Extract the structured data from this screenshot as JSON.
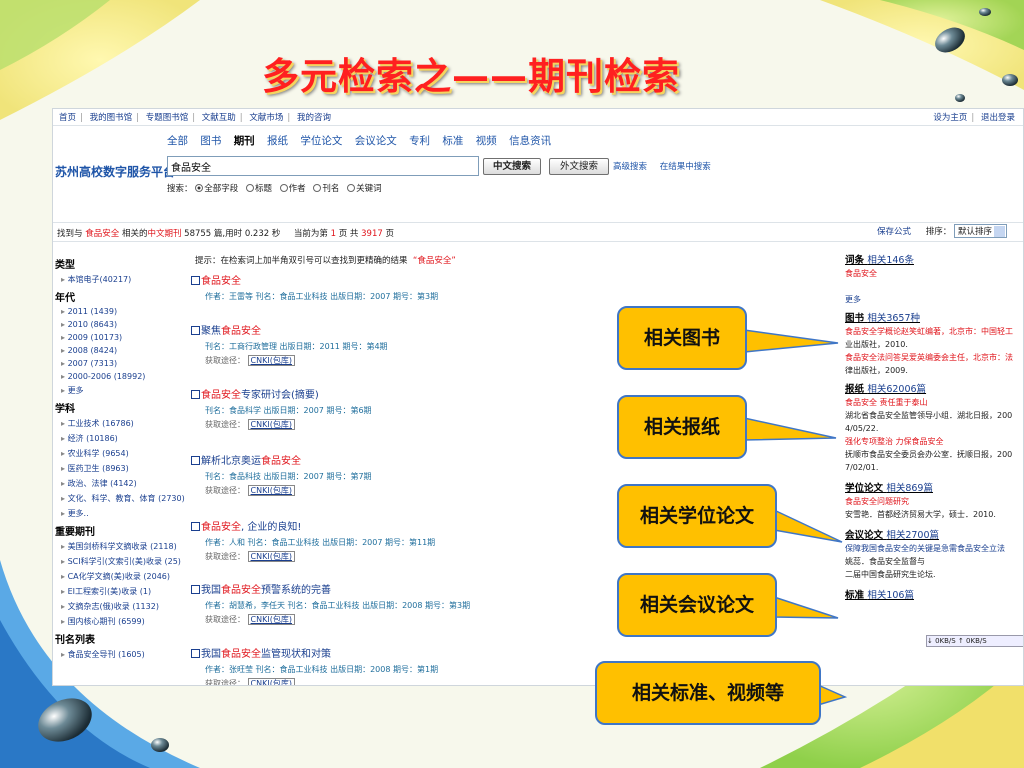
{
  "slide": {
    "title": "多元检索之——期刊检索"
  },
  "topnav": {
    "left": [
      "首页",
      "我的图书馆",
      "专题图书馆",
      "文献互助",
      "文献市场",
      "我的咨询"
    ],
    "right": [
      "设为主页",
      "退出登录"
    ]
  },
  "brand": "苏州高校数字服务平台",
  "search": {
    "types": [
      "全部",
      "图书",
      "期刊",
      "报纸",
      "学位论文",
      "会议论文",
      "专利",
      "标准",
      "视频",
      "信息资讯"
    ],
    "active_type": "期刊",
    "query": "食品安全",
    "cn_button": "中文搜索",
    "en_button": "外文搜索",
    "advanced": "高级搜索",
    "within": "在结果中搜索",
    "scope_label": "搜索：",
    "scopes": [
      "全部字段",
      "标题",
      "作者",
      "刊名",
      "关键词"
    ],
    "selected_scope": "全部字段"
  },
  "status": {
    "p1": "找到与",
    "keyword": "食品安全",
    "p2": "相关的",
    "type": "中文期刊",
    "p3": "58755 篇,用时 0.232 秒",
    "p4": "当前为第",
    "page": "1",
    "p5": "页 共",
    "total": "3917",
    "p6": "页",
    "save": "保存公式",
    "sort_label": "排序：",
    "sort_value": "默认排序"
  },
  "sidebar": [
    {
      "heading": "类型",
      "items": [
        "本馆电子(40217)"
      ]
    },
    {
      "heading": "年代",
      "items": [
        "2011 (1439)",
        "2010 (8643)",
        "2009 (10173)",
        "2008 (8424)",
        "2007 (7313)",
        "2000-2006 (18992)",
        "更多"
      ]
    },
    {
      "heading": "学科",
      "items": [
        "工业技术 (16786)",
        "经济 (10186)",
        "农业科学 (9654)",
        "医药卫生 (8963)",
        "政治、法律 (4142)",
        "文化、科学、教育、体育 (2730)",
        "更多.."
      ]
    },
    {
      "heading": "重要期刊",
      "items": [
        "美国剑桥科学文摘收录 (2118)",
        "SCI科学引(文索引(美)收录 (25)",
        "CA化学文摘(美)收录 (2046)",
        "EI工程索引(美)收录 (1)",
        "文摘杂志(俄)收录 (1132)",
        "国内核心期刊 (6599)"
      ]
    },
    {
      "heading": "刊名列表",
      "items": [
        "食品安全导刊 (1605)"
      ]
    }
  ],
  "hint": {
    "text": "提示：在检索词上加半角双引号可以查找到更精确的结果",
    "quoted": "“食品安全”"
  },
  "results": [
    {
      "pre": "",
      "hl": "食品安全",
      "post": "",
      "meta": "作者：王雷等    刊名：食品工业科技    出版日期：2007    期号：第3期",
      "route": ""
    },
    {
      "pre": "聚焦",
      "hl": "食品安全",
      "post": "",
      "meta": "刊名：工商行政管理    出版日期：2011    期号：第4期",
      "route": "CNKI(包库)"
    },
    {
      "pre": "",
      "hl": "食品安全",
      "post": "专家研讨会(摘要)",
      "meta": "刊名：食品科学    出版日期：2007    期号：第6期",
      "route": "CNKI(包库)"
    },
    {
      "pre": "解析北京奥运",
      "hl": "食品安全",
      "post": "",
      "meta": "刊名：食品科技    出版日期：2007    期号：第7期",
      "route": "CNKI(包库)"
    },
    {
      "pre": "",
      "hl": "食品安全",
      "post": ", 企业的良知!",
      "meta": "作者：人和    刊名：食品工业科技    出版日期：2007    期号：第11期",
      "route": "CNKI(包库)"
    },
    {
      "pre": "我国",
      "hl": "食品安全",
      "post": "预警系统的完善",
      "meta": "作者：胡慧希，李任天    刊名：食品工业科技    出版日期：2008    期号：第3期",
      "route": "CNKI(包库)"
    },
    {
      "pre": "我国",
      "hl": "食品安全",
      "post": "监管现状和对策",
      "meta": "作者：张旺莹    刊名：食品工业科技    出版日期：2008    期号：第1期",
      "route": "CNKI(包库)"
    }
  ],
  "route_label": "获取途径：",
  "right_panel": {
    "entry_h": "词条",
    "entry_cnt": "相关146条",
    "entry_item": "食品安全",
    "entry_more": "更多",
    "books_h": "图书",
    "books_cnt": "相关3657种",
    "books_1": "食品安全学概论赵笑虹编著，北京市：中国轻工",
    "books_1b": "业出版社，2010.",
    "books_2": "食品安全法问答吴爱英编委会主任，北京市：法",
    "books_2b": "律出版社，2009.",
    "news_h": "报纸",
    "news_cnt": "相关62006篇",
    "news_1": "食品安全 责任重于泰山",
    "news_1b": "湖北省食品安全监管领导小组．湖北日报，200",
    "news_1c": "4/05/22.",
    "news_2": "强化专项整治 力保食品安全",
    "news_2b": "抚顺市食品安全委员会办公室．抚顺日报，200",
    "news_2c": "7/02/01.",
    "thesis_h": "学位论文",
    "thesis_cnt": "相关869篇",
    "thesis_1": "食品安全问题研究",
    "thesis_1b": "安雪艳．首都经济贸易大学，硕士．2010.",
    "conf_h": "会议论文",
    "conf_cnt": "相关2700篇",
    "conf_1": "保障我国食品安全的关键是急需食品安全立法",
    "conf_1b": "姚蕊．食品安全监督与",
    "conf_1c": "二届中国食品研究生论坛.",
    "std_h": "标准",
    "std_cnt": "相关106篇"
  },
  "download_bar": "↓  0KB/S  ↑  0KB/S",
  "callouts": [
    "相关图书",
    "相关报纸",
    "相关学位论文",
    "相关会议论文",
    "相关标准、视频等"
  ]
}
